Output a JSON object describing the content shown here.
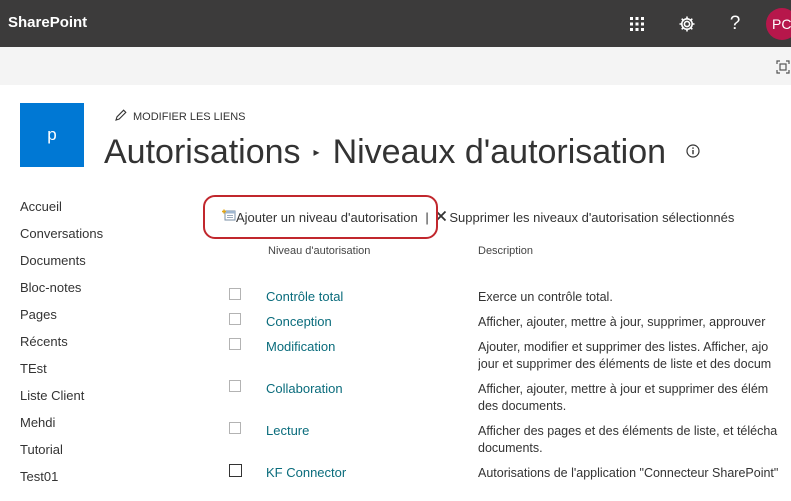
{
  "suitebar": {
    "brand": "SharePoint",
    "help_glyph": "?",
    "user_initials": "PC",
    "icons": [
      "app-launcher-icon",
      "settings-gear-icon",
      "help-icon"
    ]
  },
  "site": {
    "logo_letter": "p",
    "edit_links_label": "MODIFIER LES LIENS"
  },
  "title": {
    "parent": "Autorisations",
    "current": "Niveaux d'autorisation",
    "separator": "▸"
  },
  "nav": {
    "items": [
      "Accueil",
      "Conversations",
      "Documents",
      "Bloc-notes",
      "Pages",
      "Récents",
      "TEst",
      "Liste Client",
      "Mehdi",
      "Tutorial",
      "Test01"
    ]
  },
  "toolbar": {
    "add_label": "Ajouter un niveau d'autorisation",
    "separator": "|",
    "delete_label": "Supprimer les niveaux d'autorisation sélectionnés"
  },
  "table": {
    "columns": [
      "Niveau d'autorisation",
      "Description"
    ],
    "rows": [
      {
        "level": "Contrôle total",
        "desc": [
          "Exerce un contrôle total."
        ]
      },
      {
        "level": "Conception",
        "desc": [
          "Afficher, ajouter, mettre à jour, supprimer, approuver"
        ]
      },
      {
        "level": "Modification",
        "desc": [
          "Ajouter, modifier et supprimer des listes. Afficher, ajo",
          "jour et supprimer des éléments de liste et des docum"
        ]
      },
      {
        "level": "Collaboration",
        "desc": [
          "Afficher, ajouter, mettre à jour et supprimer des élém",
          "des documents."
        ]
      },
      {
        "level": "Lecture",
        "desc": [
          "Afficher des pages et des éléments de liste, et télécha",
          "documents."
        ]
      },
      {
        "level": "KF Connector",
        "desc": [
          "Autorisations de l'application \"Connecteur SharePoint\""
        ]
      }
    ]
  },
  "colors": {
    "suitebar": "#3c3b3b",
    "avatar": "#b7174b",
    "site_logo": "#0078d4",
    "link": "#0a6c7c",
    "highlight_circle": "#c1272d"
  }
}
